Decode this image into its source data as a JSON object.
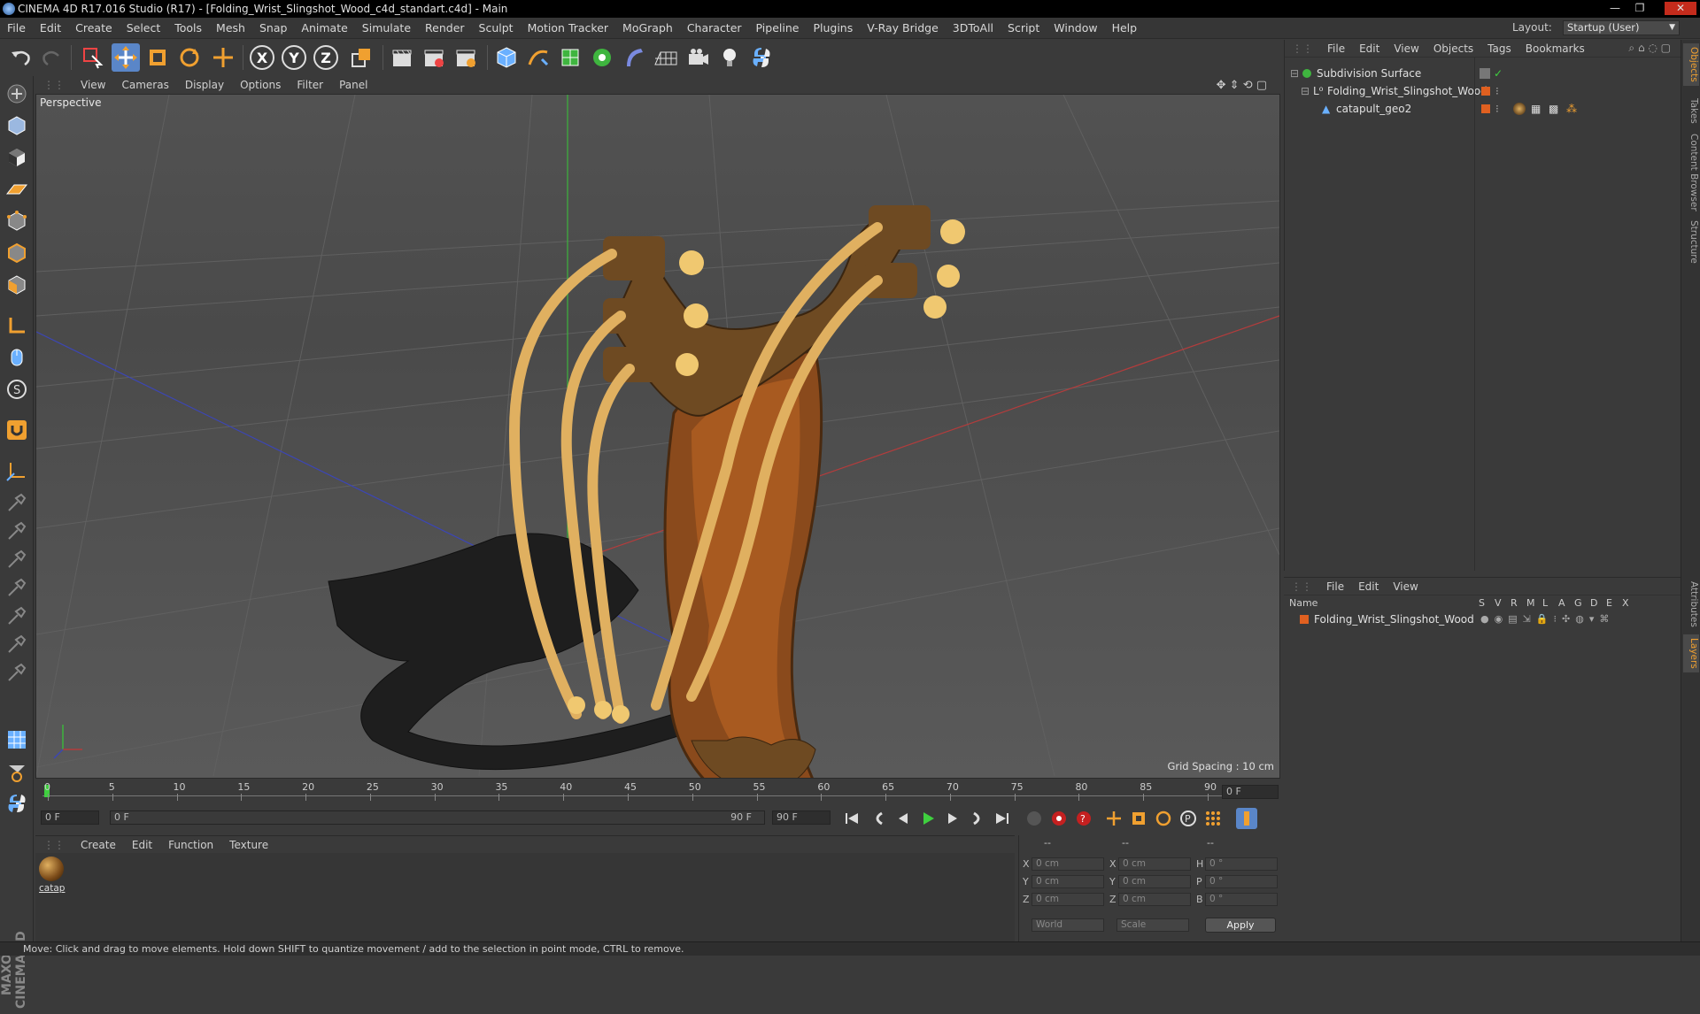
{
  "titlebar": {
    "title": "CINEMA 4D R17.016 Studio (R17) - [Folding_Wrist_Slingshot_Wood_c4d_standart.c4d] - Main",
    "minimize": "—",
    "restore": "❐",
    "close": "✕"
  },
  "menubar": {
    "items": [
      "File",
      "Edit",
      "Create",
      "Select",
      "Tools",
      "Mesh",
      "Snap",
      "Animate",
      "Simulate",
      "Render",
      "Sculpt",
      "Motion Tracker",
      "MoGraph",
      "Character",
      "Pipeline",
      "Plugins",
      "V-Ray Bridge",
      "3DToAll",
      "Script",
      "Window",
      "Help"
    ],
    "layout_label": "Layout:",
    "layout_value": "Startup (User)"
  },
  "toolbar": {
    "axis_x": "X",
    "axis_y": "Y",
    "axis_z": "Z"
  },
  "viewport": {
    "menu": [
      "View",
      "Cameras",
      "Display",
      "Options",
      "Filter",
      "Panel"
    ],
    "label": "Perspective",
    "grid_spacing": "Grid Spacing : 10 cm"
  },
  "timeline": {
    "ticks": [
      "0",
      "5",
      "10",
      "15",
      "20",
      "25",
      "30",
      "35",
      "40",
      "45",
      "50",
      "55",
      "60",
      "65",
      "70",
      "75",
      "80",
      "85",
      "90"
    ],
    "current_frame": "0 F",
    "start_field": "0 F",
    "range_start": "0 F",
    "range_end": "90 F",
    "end_field": "90 F"
  },
  "materials": {
    "menu": [
      "Create",
      "Edit",
      "Function",
      "Texture"
    ],
    "items": [
      {
        "label": "catap"
      }
    ]
  },
  "coords": {
    "headers": [
      "--",
      "--",
      "--"
    ],
    "rows": [
      {
        "a": "X",
        "av": "0 cm",
        "b": "X",
        "bv": "0 cm",
        "c": "H",
        "cv": "0 °"
      },
      {
        "a": "Y",
        "av": "0 cm",
        "b": "Y",
        "bv": "0 cm",
        "c": "P",
        "cv": "0 °"
      },
      {
        "a": "Z",
        "av": "0 cm",
        "b": "Z",
        "bv": "0 cm",
        "c": "B",
        "cv": "0 °"
      }
    ],
    "world": "World",
    "scale": "Scale",
    "apply": "Apply"
  },
  "objects": {
    "menu": [
      "File",
      "Edit",
      "View",
      "Objects",
      "Tags",
      "Bookmarks"
    ],
    "items": [
      {
        "name": "Subdivision Surface"
      },
      {
        "name": "Folding_Wrist_Slingshot_Wood"
      },
      {
        "name": "catapult_geo2"
      }
    ]
  },
  "layers": {
    "menu": [
      "File",
      "Edit",
      "View"
    ],
    "name_header": "Name",
    "cols": [
      "S",
      "V",
      "R",
      "M",
      "L",
      "A",
      "G",
      "D",
      "E",
      "X"
    ],
    "items": [
      {
        "name": "Folding_Wrist_Slingshot_Wood"
      }
    ]
  },
  "sidetabs": [
    "Objects",
    "Takes",
    "Content Browser",
    "Structure",
    "Attributes",
    "Layers"
  ],
  "status": "Move: Click and drag to move elements. Hold down SHIFT to quantize movement / add to the selection in point mode, CTRL to remove.",
  "brand": "MAXON CINEMA 4D",
  "colors": {
    "accent": "#f0a030",
    "layer": "#e06020",
    "selection": "#5a86c8"
  }
}
